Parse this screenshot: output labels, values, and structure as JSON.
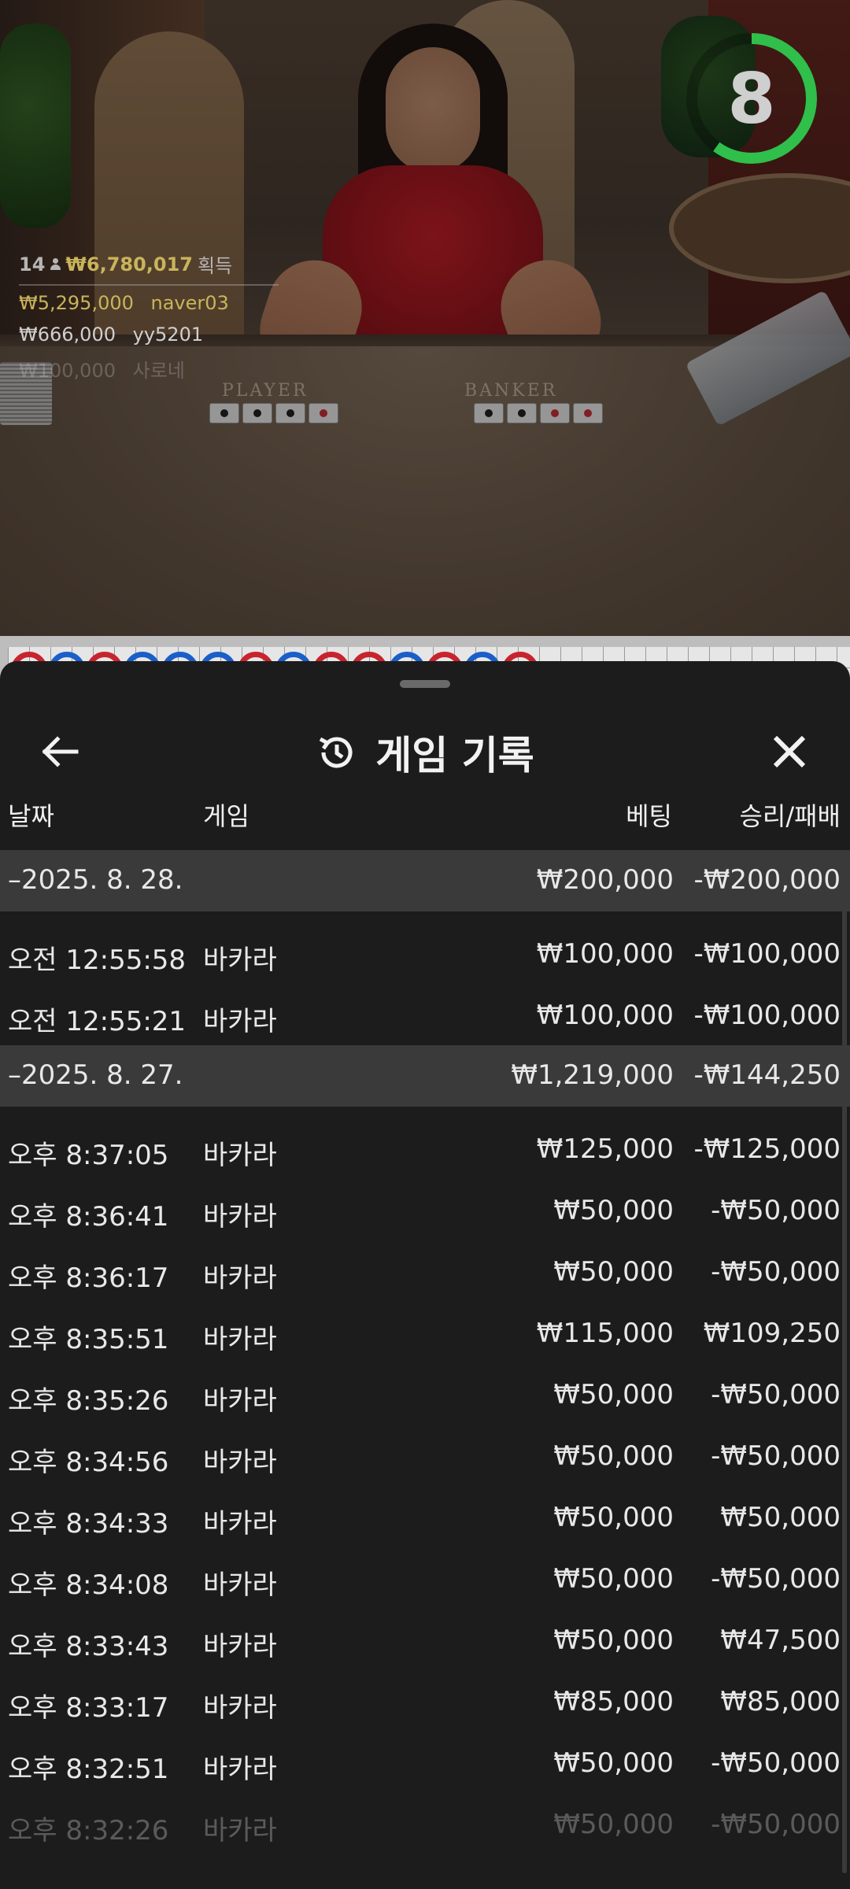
{
  "video": {
    "table_labels": {
      "player": "PLAYER",
      "banker": "BANKER"
    },
    "timer_value": "8",
    "timer_fraction": 0.6,
    "winners": {
      "count": "14",
      "total": "₩6,780,017",
      "total_label": "획득",
      "list": [
        {
          "amount": "₩5,295,000",
          "name": "naver03"
        },
        {
          "amount": "₩666,000",
          "name": "yy5201"
        },
        {
          "amount": "₩100,000",
          "name": "사로네"
        }
      ]
    }
  },
  "roadmap": {
    "circles": [
      "r",
      "b",
      "r",
      "b",
      "b",
      "b",
      "r",
      "b",
      "r",
      "r",
      "b",
      "r",
      "b",
      "r"
    ]
  },
  "sheet": {
    "title": "게임 기록",
    "columns": {
      "date": "날짜",
      "game": "게임",
      "bet": "베팅",
      "result": "승리/패배"
    },
    "groups": [
      {
        "date": "–2025. 8. 28.",
        "bet": "₩200,000",
        "result": "-₩200,000",
        "rows": [
          {
            "time": "오전 12:55:58",
            "game": "바카라",
            "bet": "₩100,000",
            "result": "-₩100,000"
          },
          {
            "time": "오전 12:55:21",
            "game": "바카라",
            "bet": "₩100,000",
            "result": "-₩100,000"
          }
        ]
      },
      {
        "date": "–2025. 8. 27.",
        "bet": "₩1,219,000",
        "result": "-₩144,250",
        "rows": [
          {
            "time": "오후 8:37:05",
            "game": "바카라",
            "bet": "₩125,000",
            "result": "-₩125,000"
          },
          {
            "time": "오후 8:36:41",
            "game": "바카라",
            "bet": "₩50,000",
            "result": "-₩50,000"
          },
          {
            "time": "오후 8:36:17",
            "game": "바카라",
            "bet": "₩50,000",
            "result": "-₩50,000"
          },
          {
            "time": "오후 8:35:51",
            "game": "바카라",
            "bet": "₩115,000",
            "result": "₩109,250"
          },
          {
            "time": "오후 8:35:26",
            "game": "바카라",
            "bet": "₩50,000",
            "result": "-₩50,000"
          },
          {
            "time": "오후 8:34:56",
            "game": "바카라",
            "bet": "₩50,000",
            "result": "-₩50,000"
          },
          {
            "time": "오후 8:34:33",
            "game": "바카라",
            "bet": "₩50,000",
            "result": "₩50,000"
          },
          {
            "time": "오후 8:34:08",
            "game": "바카라",
            "bet": "₩50,000",
            "result": "-₩50,000"
          },
          {
            "time": "오후 8:33:43",
            "game": "바카라",
            "bet": "₩50,000",
            "result": "₩47,500"
          },
          {
            "time": "오후 8:33:17",
            "game": "바카라",
            "bet": "₩85,000",
            "result": "₩85,000"
          },
          {
            "time": "오후 8:32:51",
            "game": "바카라",
            "bet": "₩50,000",
            "result": "-₩50,000"
          },
          {
            "time": "오후 8:32:26",
            "game": "바카라",
            "bet": "₩50,000",
            "result": "-₩50,000"
          }
        ]
      }
    ]
  },
  "colors": {
    "sheet_bg": "#1c1c1c",
    "group_bg": "#3a3a3a",
    "timer_green": "#2fbf4a",
    "gold": "#c9b45a",
    "banker_red": "#c8242e",
    "player_blue": "#1a5fc9"
  },
  "icons": {
    "back": "arrow-left-icon",
    "history": "history-icon",
    "close": "close-icon",
    "person": "person-icon"
  }
}
